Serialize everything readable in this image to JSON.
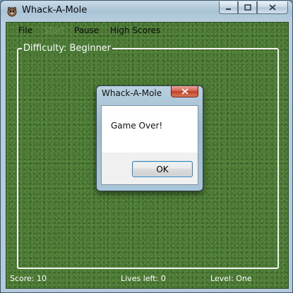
{
  "window": {
    "title": "Whack-A-Mole"
  },
  "menu": [
    {
      "label": "File",
      "enabled": true
    },
    {
      "label": "Start",
      "enabled": false
    },
    {
      "label": "Pause",
      "enabled": true
    },
    {
      "label": "High Scores",
      "enabled": true
    }
  ],
  "game": {
    "difficulty_label": "Difficulty: Beginner",
    "score_label": "Score: 10",
    "lives_label": "Lives left: 0",
    "level_label": "Level: One"
  },
  "dialog": {
    "title": "Whack-A-Mole",
    "message": "Game Over!",
    "ok_label": "OK"
  },
  "colors": {
    "field_green": "#4a7a35",
    "border_white": "#f4f6f2",
    "close_red": "#c23a23"
  }
}
